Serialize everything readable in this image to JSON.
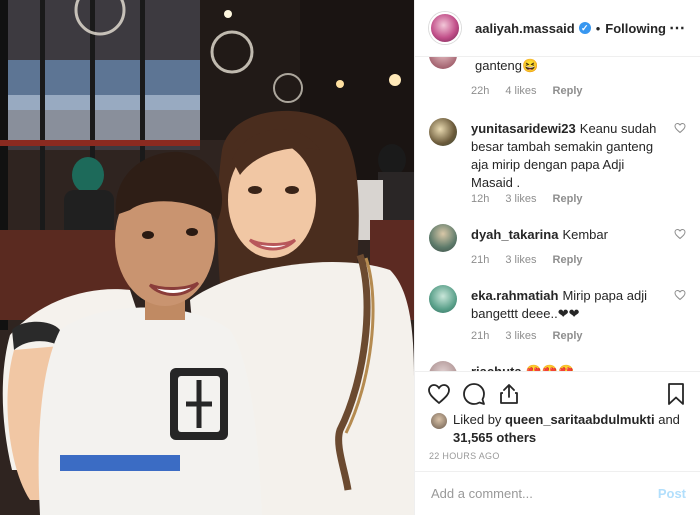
{
  "header": {
    "username": "aaliyah.massaid",
    "verified_mark": "✓",
    "separator": "•",
    "follow_status": "Following",
    "more_icon": "⋯"
  },
  "comments": [
    {
      "username": "",
      "text": "ganteng😆",
      "age": "22h",
      "likes": "4 likes",
      "reply": "Reply"
    },
    {
      "username": "yunitasaridewi23",
      "text": "Keanu sudah besar tambah semakin ganteng aja mirip dengan papa Adji Masaid .",
      "age": "12h",
      "likes": "3 likes",
      "reply": "Reply"
    },
    {
      "username": "dyah_takarina",
      "text": "Kembar",
      "age": "21h",
      "likes": "3 likes",
      "reply": "Reply"
    },
    {
      "username": "eka.rahmatiah",
      "text": "Mirip papa adji bangettt deee..❤❤",
      "age": "21h",
      "likes": "3 likes",
      "reply": "Reply"
    },
    {
      "username": "riachuta",
      "text": "😍😍😍",
      "age": "",
      "likes": "",
      "reply": ""
    }
  ],
  "likes": {
    "prefix": "Liked by",
    "user": "queen_saritaabdulmukti",
    "joiner": "and",
    "count": "31,565 others"
  },
  "timestamp": "22 HOURS AGO",
  "add_comment": {
    "placeholder": "Add a comment...",
    "post_label": "Post"
  },
  "icons": {
    "like": "heart-icon",
    "comment": "comment-icon",
    "share": "share-icon",
    "save": "bookmark-icon"
  },
  "colors": {
    "verified": "#3897f0",
    "post_disabled": "#b2dffc",
    "meta_text": "#8e8e8e"
  }
}
